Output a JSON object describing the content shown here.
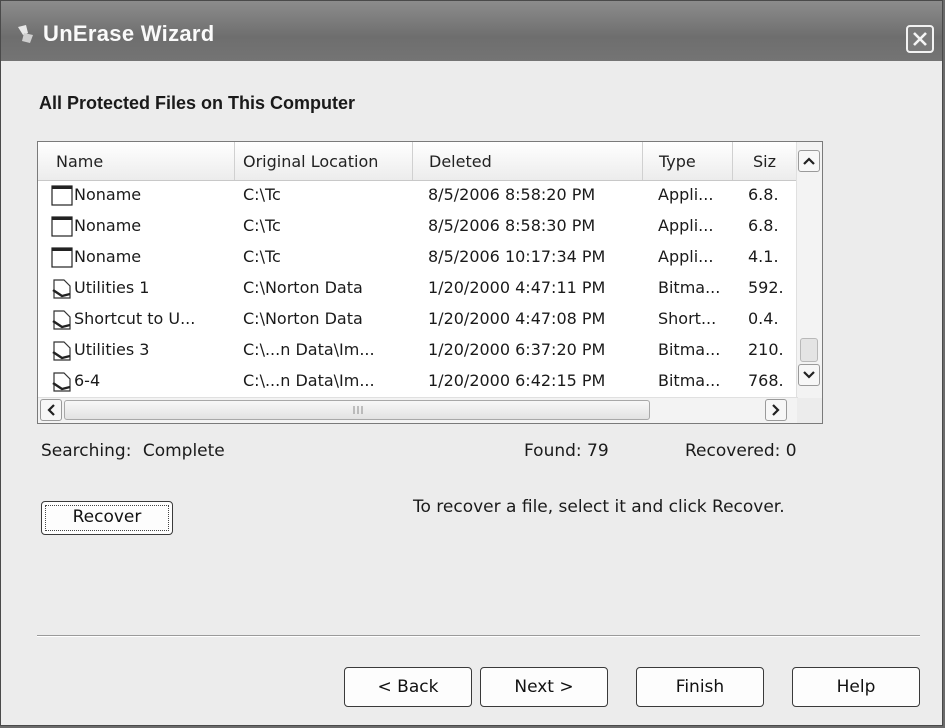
{
  "window": {
    "title": "UnErase Wizard"
  },
  "heading": "All Protected Files on This Computer",
  "list": {
    "columns": [
      {
        "label": "Name"
      },
      {
        "label": "Original Location"
      },
      {
        "label": "Deleted"
      },
      {
        "label": "Type"
      },
      {
        "label": "Siz"
      }
    ],
    "rows": [
      {
        "icon": "blank-file-icon",
        "name": "Noname",
        "location": "C:\\Tc",
        "deleted": "8/5/2006 8:58:20 PM",
        "type": "Appli...",
        "size": "6.8."
      },
      {
        "icon": "blank-file-icon",
        "name": "Noname",
        "location": "C:\\Tc",
        "deleted": "8/5/2006 8:58:30 PM",
        "type": "Appli...",
        "size": "6.8."
      },
      {
        "icon": "blank-file-icon",
        "name": "Noname",
        "location": "C:\\Tc",
        "deleted": "8/5/2006 10:17:34 PM",
        "type": "Appli...",
        "size": "4.1."
      },
      {
        "icon": "bitmap-file-icon",
        "name": "Utilities 1",
        "location": "C:\\Norton Data",
        "deleted": "1/20/2000 4:47:11 PM",
        "type": "Bitma...",
        "size": "592."
      },
      {
        "icon": "bitmap-file-icon",
        "name": "Shortcut to U...",
        "location": "C:\\Norton Data",
        "deleted": "1/20/2000 4:47:08 PM",
        "type": "Short...",
        "size": "0.4."
      },
      {
        "icon": "bitmap-file-icon",
        "name": "Utilities 3",
        "location": "C:\\...n Data\\Im...",
        "deleted": "1/20/2000 6:37:20 PM",
        "type": "Bitma...",
        "size": "210."
      },
      {
        "icon": "bitmap-file-icon",
        "name": "6-4",
        "location": "C:\\...n Data\\Im...",
        "deleted": "1/20/2000 6:42:15 PM",
        "type": "Bitma...",
        "size": "768."
      }
    ]
  },
  "status": {
    "searching_label": "Searching:",
    "searching_value": "Complete",
    "found_label": "Found:",
    "found_value": "79",
    "recovered_label": "Recovered:",
    "recovered_value": "0"
  },
  "recover": {
    "button_label": "Recover",
    "hint": "To recover a file, select it and click Recover."
  },
  "nav": {
    "back_label": "< Back",
    "next_label": "Next >",
    "finish_label": "Finish",
    "help_label": "Help"
  }
}
